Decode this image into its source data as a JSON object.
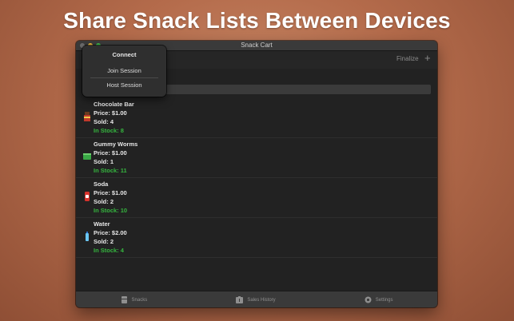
{
  "headline": "Share Snack Lists Between Devices",
  "window": {
    "title": "Snack Cart",
    "finalize_label": "Finalize",
    "add_symbol": "+"
  },
  "popover": {
    "title": "Connect",
    "items": [
      {
        "label": "Join Session"
      },
      {
        "label": "Host Session"
      }
    ]
  },
  "snacks": [
    {
      "name": "Chocolate Bar",
      "price": "Price: $1.00",
      "sold": "Sold: 4",
      "stock": "In Stock: 8",
      "icon": "chocolate-bar-icon"
    },
    {
      "name": "Gummy Worms",
      "price": "Price: $1.00",
      "sold": "Sold: 1",
      "stock": "In Stock: 11",
      "icon": "gummy-worms-icon"
    },
    {
      "name": "Soda",
      "price": "Price: $1.00",
      "sold": "Sold: 2",
      "stock": "In Stock: 10",
      "icon": "soda-can-icon"
    },
    {
      "name": "Water",
      "price": "Price: $2.00",
      "sold": "Sold: 2",
      "stock": "In Stock: 4",
      "icon": "water-bottle-icon"
    }
  ],
  "tabs": [
    {
      "label": "Snacks",
      "icon": "snacks-icon"
    },
    {
      "label": "Sales History",
      "icon": "sales-history-icon"
    },
    {
      "label": "Settings",
      "icon": "settings-gear-icon"
    }
  ],
  "colors": {
    "in_stock": "#35b53f",
    "traffic_min": "#e2b23a",
    "traffic_max": "#3fb34a"
  }
}
